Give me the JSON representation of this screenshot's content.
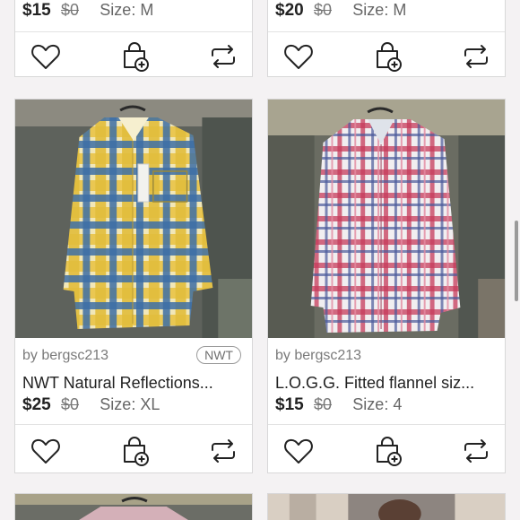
{
  "cards": [
    {
      "price": "$15",
      "original_price": "$0",
      "size": "Size: M"
    },
    {
      "price": "$20",
      "original_price": "$0",
      "size": "Size: M"
    },
    {
      "seller": "by bergsc213",
      "badge": "NWT",
      "title": "NWT Natural Reflections...",
      "price": "$25",
      "original_price": "$0",
      "size": "Size: XL"
    },
    {
      "seller": "by bergsc213",
      "title": "L.O.G.G. Fitted flannel siz...",
      "price": "$15",
      "original_price": "$0",
      "size": "Size: 4"
    }
  ],
  "icons": {
    "like": "heart-icon",
    "bundle": "shopping-bag-add-icon",
    "share": "share-icon"
  },
  "colors": {
    "price": "#222222",
    "muted": "#777777"
  }
}
